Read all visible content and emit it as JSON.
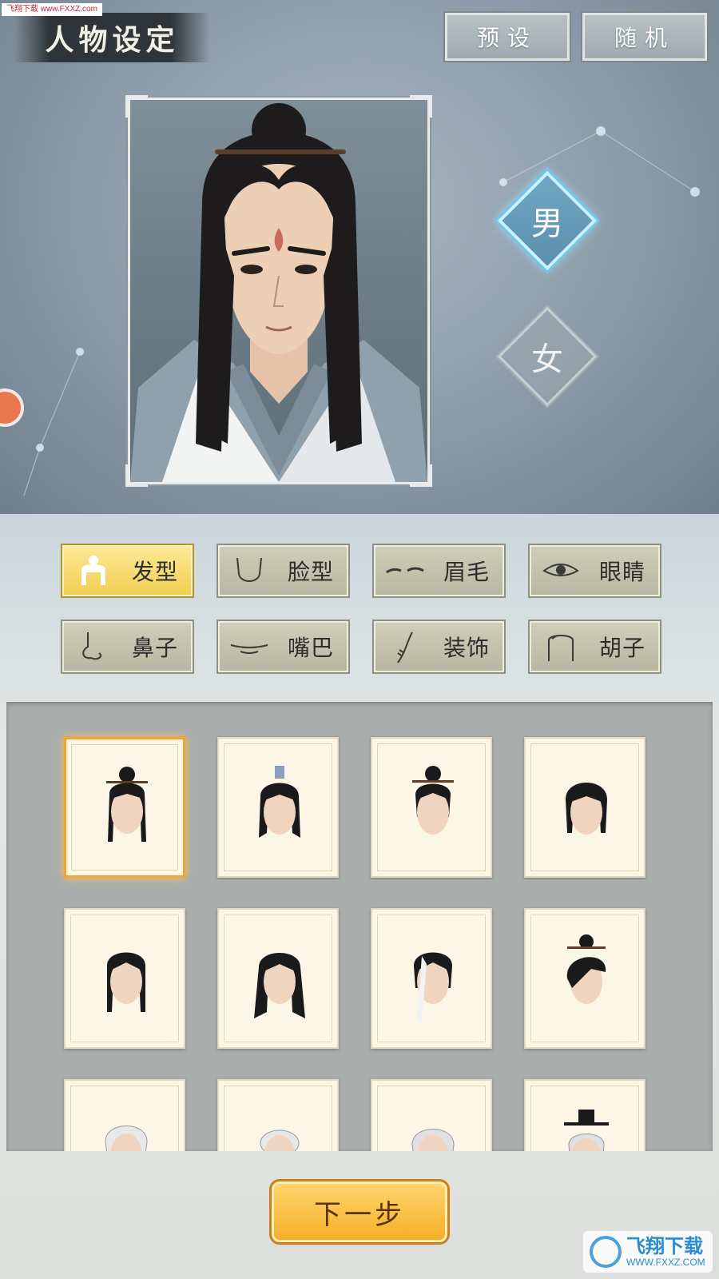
{
  "watermark_top": "飞翔下载 www.FXXZ.com",
  "header": {
    "title": "人物设定",
    "preset_label": "预设",
    "random_label": "随机"
  },
  "gender": {
    "male_label": "男",
    "female_label": "女",
    "selected": "男"
  },
  "categories": [
    {
      "label": "发型",
      "icon": "hair-icon",
      "active": true
    },
    {
      "label": "脸型",
      "icon": "face-shape-icon",
      "active": false
    },
    {
      "label": "眉毛",
      "icon": "eyebrow-icon",
      "active": false
    },
    {
      "label": "眼睛",
      "icon": "eye-icon",
      "active": false
    },
    {
      "label": "鼻子",
      "icon": "nose-icon",
      "active": false
    },
    {
      "label": "嘴巴",
      "icon": "mouth-icon",
      "active": false
    },
    {
      "label": "装饰",
      "icon": "decoration-icon",
      "active": false
    },
    {
      "label": "胡子",
      "icon": "beard-icon",
      "active": false
    }
  ],
  "hairstyles": {
    "selected_index": 0,
    "items": [
      {
        "style": "topknot-long-strands",
        "hair_color": "#1a1a1a"
      },
      {
        "style": "crown-long",
        "hair_color": "#1a1a1a"
      },
      {
        "style": "topknot-short",
        "hair_color": "#1a1a1a"
      },
      {
        "style": "bob",
        "hair_color": "#1a1a1a"
      },
      {
        "style": "side-strands",
        "hair_color": "#1a1a1a"
      },
      {
        "style": "long-loose",
        "hair_color": "#1a1a1a"
      },
      {
        "style": "white-streak",
        "hair_color": "#1a1a1a"
      },
      {
        "style": "topknot-fringe",
        "hair_color": "#1a1a1a"
      },
      {
        "style": "white-swept",
        "hair_color": "#e8e8e8"
      },
      {
        "style": "white-bun",
        "hair_color": "#e8e8e8"
      },
      {
        "style": "white-wavy",
        "hair_color": "#e0e0e0"
      },
      {
        "style": "white-hat",
        "hair_color": "#e0e0e0"
      }
    ]
  },
  "next_label": "下一步",
  "watermark_bottom": {
    "brand": "飞翔下载",
    "url": "WWW.FXXZ.COM"
  },
  "colors": {
    "accent_gold": "#f1cf52",
    "selected_border": "#f0a632",
    "gender_glow": "#72c8e6"
  }
}
